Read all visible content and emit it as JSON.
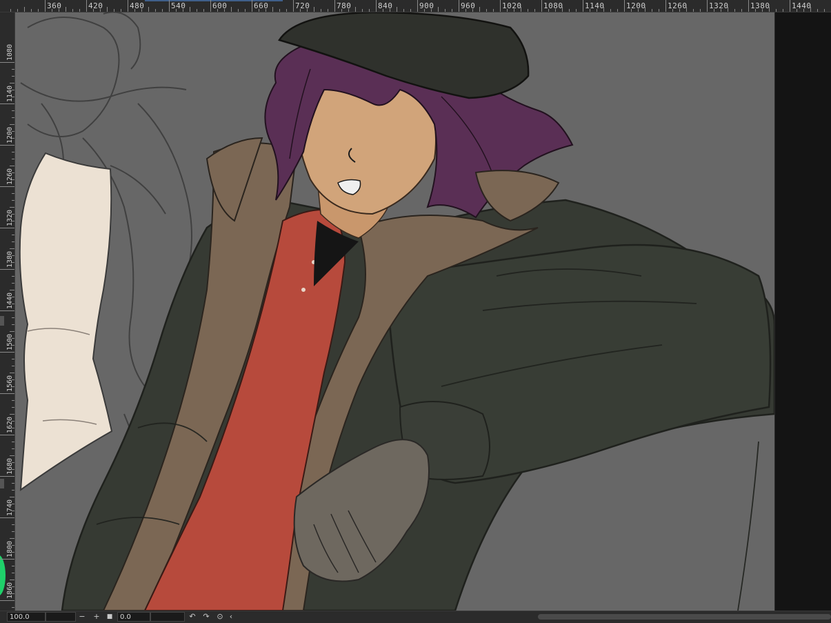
{
  "ruler": {
    "top_labels": [
      "360",
      "420",
      "480",
      "540",
      "600",
      "660",
      "720",
      "780",
      "840",
      "900",
      "960",
      "1020",
      "1080",
      "1140",
      "1200",
      "1260",
      "1320",
      "1380",
      "1440"
    ],
    "left_labels": [
      "1080",
      "1140",
      "1200",
      "1260",
      "1320",
      "1380",
      "1440",
      "1500",
      "1560",
      "1620",
      "1680",
      "1740",
      "1800",
      "1860"
    ]
  },
  "status_bar": {
    "zoom_value": "100.0",
    "zoom_out_label": "−",
    "zoom_in_label": "+",
    "stop_label": "■",
    "rotation_value": "0.0",
    "rotate_ccw_icon": "↶",
    "rotate_cw_icon": "↷",
    "reset_icon": "⊙",
    "collapse_icon": "‹"
  },
  "colors": {
    "canvas_bg": "#676767",
    "jacket": "#363a33",
    "coat": "#7b6754",
    "shirt": "#b74a3c",
    "skin": "#d1a47a",
    "hair": "#5a2f55",
    "hat": "#2f312c",
    "sleeve_light": "#ece1d3",
    "accent_green": "#1fd16a"
  }
}
